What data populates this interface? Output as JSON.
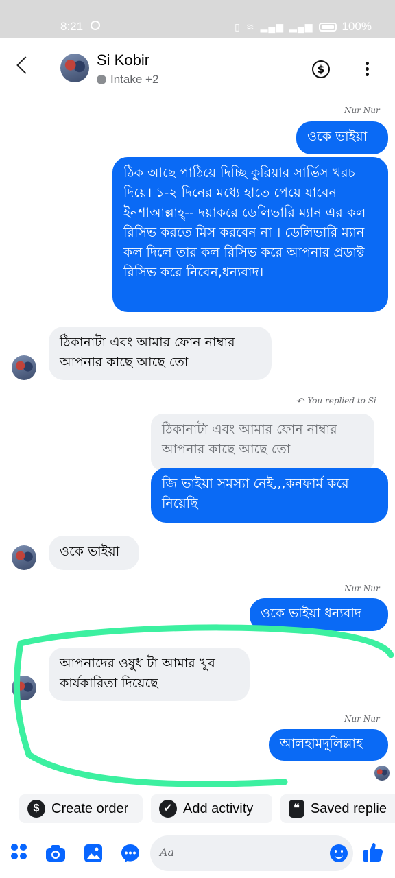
{
  "status_bar": {
    "time": "8:21",
    "battery": "100%"
  },
  "header": {
    "name": "Si Kobir",
    "subtitle": "Intake +2"
  },
  "messages": [
    {
      "sender": "Nur Nur"
    },
    {
      "text": "ওকে ভাইয়া"
    },
    {
      "text": "ঠিক আছে পাঠিয়ে দিচ্ছি কুরিয়ার সার্ভিস খরচ দিয়ে। ১-২ দিনের মধ্যে হাতে পেয়ে যাবেন ইনশাআল্লাহ্-- দয়াকরে ডেলিভারি ম্যান এর কল রিসিভ করতে মিস করবেন না । ডেলিভারি ম্যান কল দিলে তার কল রিসিভ করে আপনার প্রডাক্ট রিসিভ করে নিবেন,ধন্যবাদ।"
    },
    {
      "text": "ঠিকানাটা এবং আমার ফোন নাম্বার আপনার কাছে আছে তো"
    },
    {
      "reply_label": "You replied to Si"
    },
    {
      "quote": "ঠিকানাটা এবং আমার ফোন নাম্বার আপনার কাছে আছে তো"
    },
    {
      "text": "জি ভাইয়া সমস্যা নেই,,,কনফার্ম করে নিয়েছি"
    },
    {
      "text": "ওকে ভাইয়া"
    },
    {
      "sender": "Nur Nur"
    },
    {
      "text": "ওকে ভাইয়া ধন্যবাদ"
    },
    {
      "text": "আপনাদের ওষুধ টা আমার খুব কার্যকারিতা দিয়েছে"
    },
    {
      "sender": "Nur Nur"
    },
    {
      "text": "আলহামদুলিল্লাহ"
    }
  ],
  "quick_actions": [
    {
      "label": "Create order",
      "icon": "dollar-icon"
    },
    {
      "label": "Add activity",
      "icon": "check-icon"
    },
    {
      "label": "Saved replie",
      "icon": "chat-bubbles-icon"
    }
  ],
  "composer": {
    "placeholder": "Aa"
  },
  "colors": {
    "outgoing": "#0a6af5",
    "incoming": "#eef0f3",
    "highlight": "#3cf0a0"
  }
}
